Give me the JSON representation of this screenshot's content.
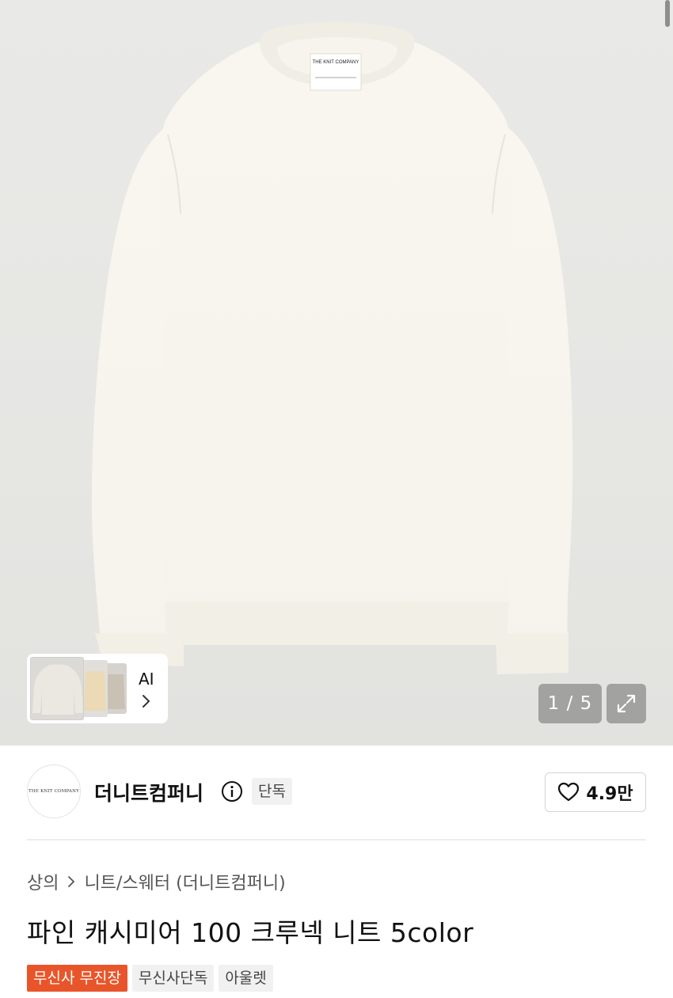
{
  "product_image": {
    "collar_label": "THE KNIT COMPANY",
    "counter": "1 / 5",
    "expand_icon": "expand-arrows-icon"
  },
  "ai_card": {
    "label": "AI",
    "chevron_icon": "chevron-right-icon"
  },
  "brand": {
    "logo_text": "THE KNIT COMPANY",
    "name": "더니트컴퍼니",
    "info_icon": "info-circle-icon",
    "badge": "단독",
    "like_icon": "heart-outline-icon",
    "like_count": "4.9만"
  },
  "breadcrumb": {
    "category": "상의",
    "separator_icon": "chevron-right-icon",
    "subcategory": "니트/스웨터 (더니트컴퍼니)"
  },
  "product": {
    "title": "파인 캐시미어 100 크루넥 니트 5color",
    "tags": [
      "무신사 무진장",
      "무신사단독",
      "아울렛"
    ]
  },
  "colors": {
    "accent_tag": "#e9552a",
    "sweater": "#f7f5ee",
    "background": "#e7e7e4"
  }
}
